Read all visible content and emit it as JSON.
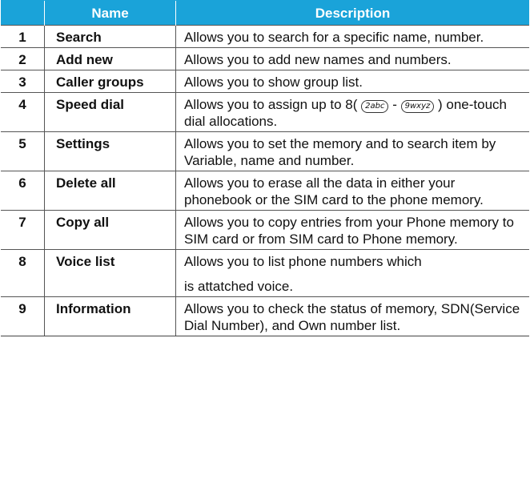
{
  "table": {
    "headers": {
      "number": "",
      "name": "Name",
      "description": "Description"
    },
    "rows": [
      {
        "number": "1",
        "name": "Search",
        "description": "Allows you to search for a specific name, number."
      },
      {
        "number": "2",
        "name": "Add new",
        "description": "Allows you to add new names and numbers."
      },
      {
        "number": "3",
        "name": "Caller groups",
        "description": "Allows you to show group list."
      },
      {
        "number": "4",
        "name": "Speed dial",
        "description_pre": "Allows you to assign up to 8(",
        "key_start": "2abc",
        "key_sep": "-",
        "key_end": "9wxyz",
        "description_post": ") one-touch dial allocations."
      },
      {
        "number": "5",
        "name": "Settings",
        "description": "Allows you to set the memory and to search item by Variable, name and number."
      },
      {
        "number": "6",
        "name": "Delete all",
        "description": "Allows you to erase all the data in either your phonebook or the SIM card to the phone memory."
      },
      {
        "number": "7",
        "name": "Copy all",
        "description": "Allows you to copy entries from your Phone memory to SIM card or from SIM card to Phone memory."
      },
      {
        "number": "8",
        "name": "Voice list",
        "description_line1": "Allows you to list phone numbers which",
        "description_line2": "is attatched voice."
      },
      {
        "number": "9",
        "name": "Information",
        "description": "Allows you to check the status of memory, SDN(Service Dial Number), and Own number list."
      }
    ]
  },
  "colors": {
    "header_bg": "#1aa3d9",
    "header_text": "#ffffff",
    "border": "#555555"
  }
}
